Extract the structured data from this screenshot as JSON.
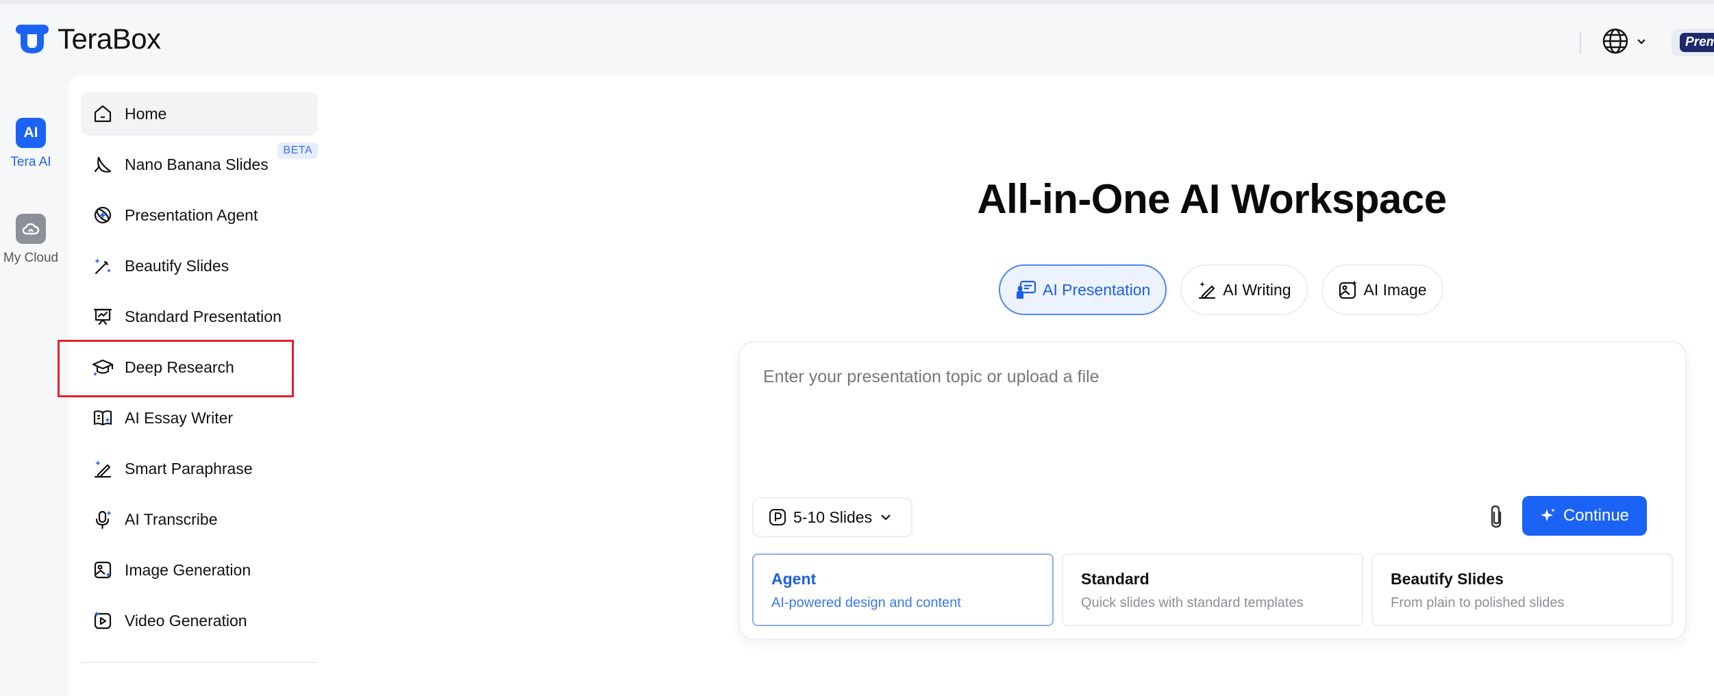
{
  "app": {
    "name": "TeraBox",
    "brand_color": "#1b63f5"
  },
  "header": {
    "premium_label": "Premi"
  },
  "rail": {
    "items": [
      {
        "label": "Tera AI",
        "icon": "ai-icon",
        "active": true
      },
      {
        "label": "My Cloud",
        "icon": "cloud-icon",
        "active": false
      }
    ]
  },
  "sidebar": {
    "beta_badge": "BETA",
    "items": [
      {
        "label": "Home",
        "icon": "home-icon"
      },
      {
        "label": "Nano Banana Slides",
        "icon": "banana-icon"
      },
      {
        "label": "Presentation Agent",
        "icon": "agent-icon"
      },
      {
        "label": "Beautify Slides",
        "icon": "magic-wand-icon"
      },
      {
        "label": "Standard Presentation",
        "icon": "presentation-icon"
      },
      {
        "label": "Deep Research",
        "icon": "graduation-cap-icon"
      },
      {
        "label": "AI Essay Writer",
        "icon": "book-icon"
      },
      {
        "label": "Smart Paraphrase",
        "icon": "pen-sparkle-icon"
      },
      {
        "label": "AI Transcribe",
        "icon": "microphone-icon"
      },
      {
        "label": "Image Generation",
        "icon": "image-icon"
      },
      {
        "label": "Video Generation",
        "icon": "video-icon"
      }
    ]
  },
  "main": {
    "title": "All-in-One AI Workspace",
    "tabs": [
      {
        "label": "AI Presentation",
        "icon": "presentation-icon",
        "active": true
      },
      {
        "label": "AI Writing",
        "icon": "pen-icon",
        "active": false
      },
      {
        "label": "AI Image",
        "icon": "image-sparkle-icon",
        "active": false
      }
    ],
    "composer": {
      "placeholder": "Enter your presentation topic or upload a file",
      "value": "",
      "slides_select": "5-10 Slides",
      "continue_label": "Continue"
    },
    "types": [
      {
        "title": "Agent",
        "desc": "AI-powered design and content",
        "active": true
      },
      {
        "title": "Standard",
        "desc": "Quick slides with standard templates",
        "active": false
      },
      {
        "title": "Beautify Slides",
        "desc": "From plain to polished slides",
        "active": false
      }
    ]
  }
}
